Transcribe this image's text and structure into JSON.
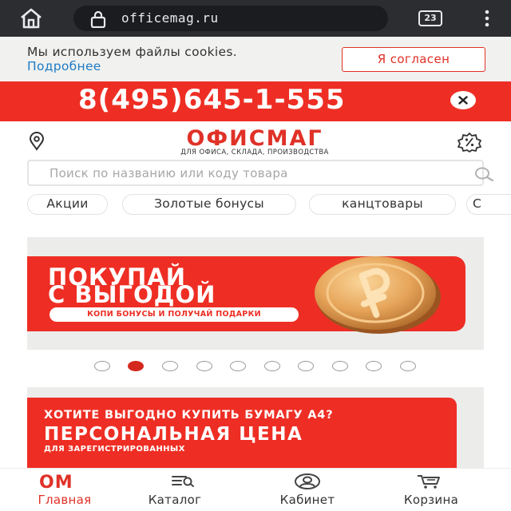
{
  "browser": {
    "url": "officemag.ru",
    "tab_count": "23"
  },
  "cookie": {
    "text": "Мы используем файлы cookies.",
    "more_link": "Подробнее",
    "accept_button": "Я согласен"
  },
  "phone_banner": {
    "number": "8(495)645-1-555"
  },
  "header": {
    "logo_title": "ОФИСМАГ",
    "logo_subtitle": "ДЛЯ ОФИСА, СКЛАДА, ПРОИЗВОДСТВА"
  },
  "search": {
    "placeholder": "Поиск по названию или коду товара"
  },
  "chips": [
    {
      "label": "Акции"
    },
    {
      "label": "Золотые бонусы"
    },
    {
      "label": "канцтовары"
    },
    {
      "label": "С"
    }
  ],
  "slider1": {
    "line1": "ПОКУПАЙ",
    "line2": "С ВЫГОДОЙ",
    "pill": "КОПИ БОНУСЫ И ПОЛУЧАЙ ПОДАРКИ",
    "dots_total": 10,
    "active_dot": 2
  },
  "slider2": {
    "line1": "ХОТИТЕ ВЫГОДНО КУПИТЬ БУМАГУ А4?",
    "line2": "ПЕРСОНАЛЬНАЯ ЦЕНА",
    "line3": "ДЛЯ ЗАРЕГИСТРИРОВАННЫХ"
  },
  "bottom_nav": {
    "home_logo": "ОМ",
    "items": [
      {
        "label": "Главная",
        "icon": "om-logo-icon",
        "active": true
      },
      {
        "label": "Каталог",
        "icon": "catalog-search-icon",
        "active": false
      },
      {
        "label": "Кабинет",
        "icon": "user-account-icon",
        "active": false
      },
      {
        "label": "Корзина",
        "icon": "cart-icon",
        "active": false
      }
    ]
  },
  "colors": {
    "brand_red": "#ee2e24",
    "link_blue": "#1e7bc6",
    "chrome_dark": "#2b2d31"
  }
}
